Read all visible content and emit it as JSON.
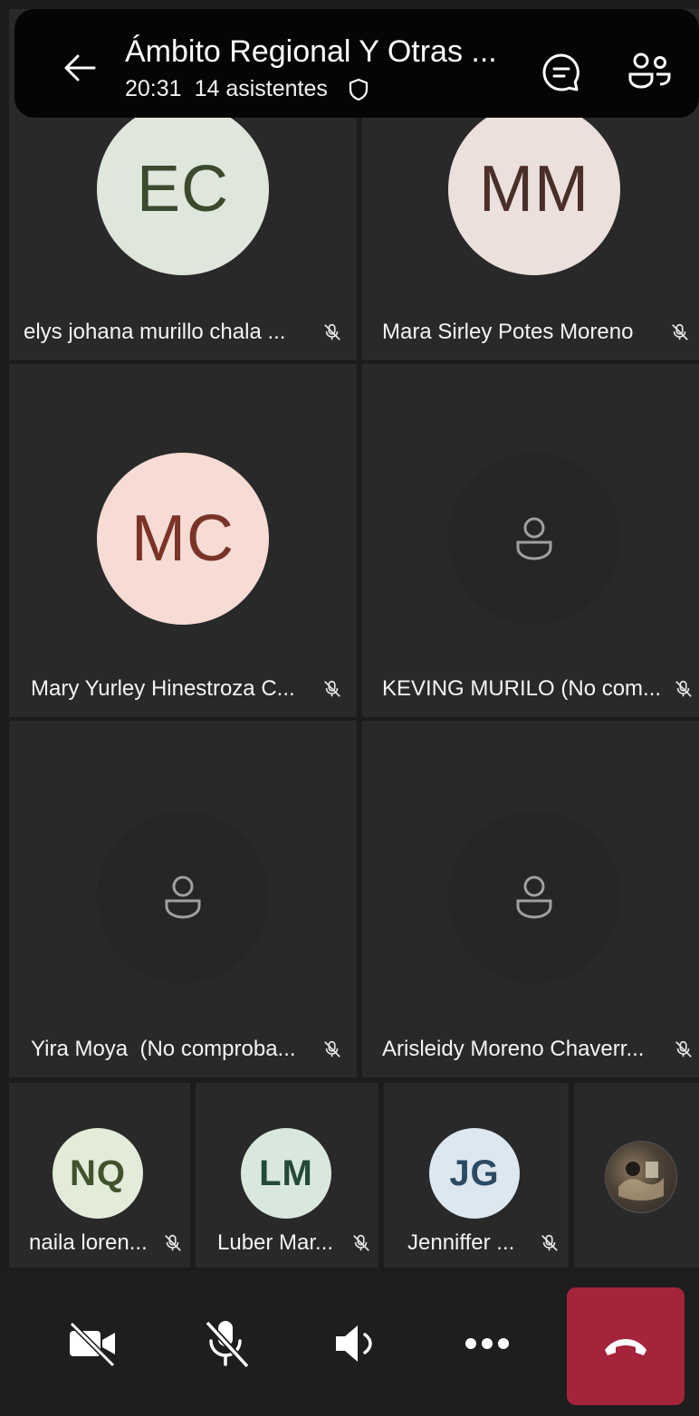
{
  "header": {
    "title": "Ámbito Regional Y Otras ...",
    "time": "20:31",
    "attendees": "14 asistentes",
    "icons": {
      "back": "arrow-left-icon",
      "shield": "shield-icon",
      "chat": "chat-icon",
      "people": "people-icon"
    }
  },
  "participants": [
    {
      "name": "elys johana murillo chala ...",
      "initials": "EC",
      "avatar_bg": "#dfe6dc",
      "avatar_fg": "#3a4a2c",
      "muted": true
    },
    {
      "name": "Mara Sirley Potes Moreno",
      "initials": "MM",
      "avatar_bg": "#ece0dc",
      "avatar_fg": "#4a2f28",
      "muted": true
    },
    {
      "name": "Mary Yurley Hinestroza C...",
      "initials": "MC",
      "avatar_bg": "#f6dcd4",
      "avatar_fg": "#7a3427",
      "muted": true
    },
    {
      "name": "KEVING MURILO (No com...",
      "initials": "",
      "avatar_bg": "#262626",
      "muted": true
    },
    {
      "name": "Yira Moya  (No comproba...",
      "initials": "",
      "avatar_bg": "#262626",
      "muted": true
    },
    {
      "name": "Arisleidy Moreno Chaverr...",
      "initials": "",
      "avatar_bg": "#262626",
      "muted": true
    }
  ],
  "strip": [
    {
      "name": "naila loren...",
      "initials": "NQ",
      "avatar_bg": "#e3ecd9",
      "avatar_fg": "#40532c",
      "muted": true
    },
    {
      "name": "Luber Mar...",
      "initials": "LM",
      "avatar_bg": "#d8e8dd",
      "avatar_fg": "#254a37",
      "muted": true
    },
    {
      "name": "Jenniffer ...",
      "initials": "JG",
      "avatar_bg": "#dde7ef",
      "avatar_fg": "#2d4a63",
      "muted": true
    },
    {
      "name": "",
      "initials": "",
      "photo": true
    }
  ],
  "toolbar": {
    "camera": "camera-off-icon",
    "mic": "mic-off-icon",
    "speaker": "speaker-icon",
    "more": "more-icon",
    "hangup": "hang-up-icon",
    "hangup_color": "#a4243b"
  }
}
